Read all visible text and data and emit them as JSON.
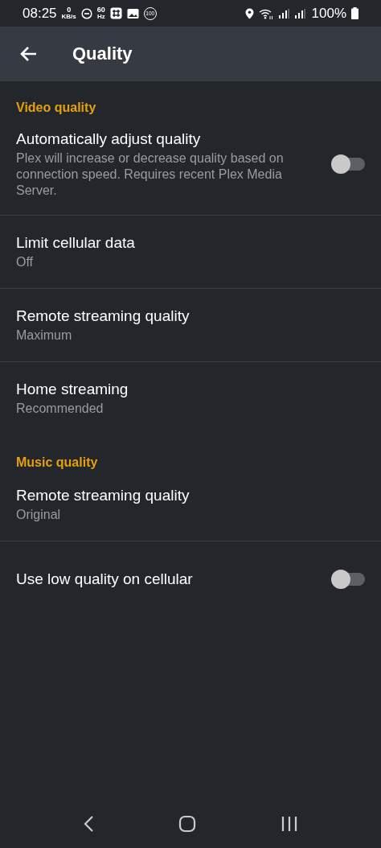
{
  "status_bar": {
    "time": "08:25",
    "net_speed": "0",
    "net_unit": "KB/s",
    "refresh_rate": "60",
    "refresh_unit": "Hz",
    "badge": "100",
    "battery": "100%"
  },
  "app_bar": {
    "title": "Quality"
  },
  "sections": [
    {
      "title": "Video quality",
      "items": [
        {
          "kind": "toggle",
          "title": "Automatically adjust quality",
          "summary": "Plex will increase or decrease quality based on connection speed. Requires recent Plex Media Server.",
          "on": false,
          "divider_below": true
        },
        {
          "kind": "value",
          "title": "Limit cellular data",
          "summary": "Off",
          "divider_below": true
        },
        {
          "kind": "value",
          "title": "Remote streaming quality",
          "summary": "Maximum",
          "divider_below": true
        },
        {
          "kind": "value",
          "title": "Home streaming",
          "summary": "Recommended",
          "divider_below": false
        }
      ]
    },
    {
      "title": "Music quality",
      "items": [
        {
          "kind": "value",
          "title": "Remote streaming quality",
          "summary": "Original",
          "divider_below": true
        },
        {
          "kind": "toggle",
          "title": "Use low quality on cellular",
          "on": false,
          "divider_below": false
        }
      ]
    }
  ]
}
